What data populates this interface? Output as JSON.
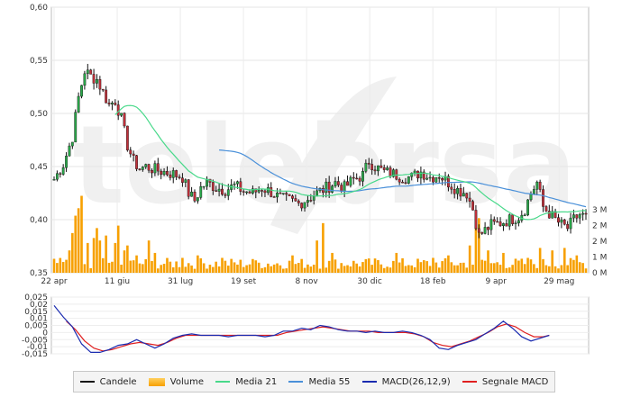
{
  "chart_data": [
    {
      "type": "candlestick",
      "title": "",
      "watermark": "telebrsa",
      "x_tick_labels": [
        "22 apr",
        "11 giu",
        "31 lug",
        "19 set",
        "8 nov",
        "30 dic",
        "18 feb",
        "9 apr",
        "29 mag"
      ],
      "y_tick_labels": [
        "0,35",
        "0,40",
        "0,45",
        "0,50",
        "0,55",
        "0,60"
      ],
      "ylim": [
        0.35,
        0.6
      ],
      "grid": true,
      "price_anchors": [
        [
          0,
          0.438
        ],
        [
          3,
          0.452
        ],
        [
          6,
          0.478
        ],
        [
          8,
          0.515
        ],
        [
          10,
          0.54
        ],
        [
          12,
          0.535
        ],
        [
          14,
          0.532
        ],
        [
          16,
          0.52
        ],
        [
          18,
          0.508
        ],
        [
          20,
          0.512
        ],
        [
          22,
          0.495
        ],
        [
          24,
          0.47
        ],
        [
          26,
          0.455
        ],
        [
          28,
          0.448
        ],
        [
          30,
          0.45
        ],
        [
          33,
          0.447
        ],
        [
          36,
          0.445
        ],
        [
          39,
          0.443
        ],
        [
          42,
          0.44
        ],
        [
          44,
          0.425
        ],
        [
          46,
          0.418
        ],
        [
          48,
          0.43
        ],
        [
          50,
          0.435
        ],
        [
          53,
          0.43
        ],
        [
          56,
          0.428
        ],
        [
          59,
          0.432
        ],
        [
          62,
          0.427
        ],
        [
          65,
          0.425
        ],
        [
          68,
          0.43
        ],
        [
          71,
          0.426
        ],
        [
          74,
          0.42
        ],
        [
          77,
          0.418
        ],
        [
          80,
          0.415
        ],
        [
          83,
          0.42
        ],
        [
          86,
          0.425
        ],
        [
          89,
          0.43
        ],
        [
          92,
          0.435
        ],
        [
          95,
          0.43
        ],
        [
          98,
          0.438
        ],
        [
          101,
          0.442
        ],
        [
          103,
          0.455
        ],
        [
          105,
          0.45
        ],
        [
          108,
          0.445
        ],
        [
          111,
          0.443
        ],
        [
          114,
          0.44
        ],
        [
          117,
          0.44
        ],
        [
          120,
          0.445
        ],
        [
          123,
          0.44
        ],
        [
          126,
          0.442
        ],
        [
          129,
          0.435
        ],
        [
          132,
          0.428
        ],
        [
          135,
          0.425
        ],
        [
          137,
          0.41
        ],
        [
          139,
          0.385
        ],
        [
          141,
          0.39
        ],
        [
          143,
          0.395
        ],
        [
          146,
          0.397
        ],
        [
          149,
          0.4
        ],
        [
          152,
          0.403
        ],
        [
          154,
          0.41
        ],
        [
          156,
          0.425
        ],
        [
          158,
          0.435
        ],
        [
          160,
          0.412
        ],
        [
          162,
          0.406
        ],
        [
          164,
          0.4
        ],
        [
          166,
          0.395
        ],
        [
          168,
          0.392
        ],
        [
          170,
          0.4
        ],
        [
          172,
          0.405
        ],
        [
          174,
          0.402
        ]
      ],
      "series": [
        {
          "name": "Candele",
          "color": "#111111"
        },
        {
          "name": "Volume",
          "color": "#f7a000"
        },
        {
          "name": "Media 21",
          "color": "#48d98a"
        },
        {
          "name": "Media 55",
          "color": "#4a90d9"
        }
      ],
      "volume_axis": {
        "tick_labels": [
          "0 M",
          "1 M",
          "2 M",
          "2 M",
          "3 M"
        ],
        "ylim_millions": [
          0,
          3.3
        ],
        "spikes": [
          [
            5,
            0.9
          ],
          [
            6,
            1.6
          ],
          [
            7,
            2.3
          ],
          [
            8,
            2.6
          ],
          [
            9,
            3.1
          ],
          [
            11,
            1.2
          ],
          [
            13,
            1.4
          ],
          [
            14,
            1.8
          ],
          [
            15,
            1.3
          ],
          [
            17,
            1.5
          ],
          [
            20,
            1.2
          ],
          [
            21,
            1.9
          ],
          [
            23,
            0.9
          ],
          [
            24,
            1.1
          ],
          [
            27,
            0.7
          ],
          [
            31,
            1.3
          ],
          [
            33,
            0.8
          ],
          [
            42,
            0.6
          ],
          [
            47,
            0.7
          ],
          [
            55,
            0.6
          ],
          [
            66,
            0.5
          ],
          [
            78,
            0.7
          ],
          [
            86,
            1.3
          ],
          [
            88,
            2.0
          ],
          [
            91,
            0.8
          ],
          [
            112,
            0.8
          ],
          [
            124,
            0.6
          ],
          [
            129,
            0.7
          ],
          [
            136,
            1.1
          ],
          [
            138,
            1.8
          ],
          [
            139,
            2.2
          ],
          [
            142,
            0.9
          ],
          [
            147,
            0.8
          ],
          [
            155,
            0.6
          ],
          [
            159,
            1.0
          ],
          [
            163,
            0.9
          ],
          [
            167,
            1.0
          ],
          [
            171,
            0.7
          ]
        ]
      }
    },
    {
      "type": "line",
      "title": "",
      "y_tick_labels": [
        "-0,015",
        "-0,01",
        "-0,005",
        "0",
        "0,005",
        "0,01",
        "0,015",
        "0,02",
        "0,025"
      ],
      "ylim": [
        -0.015,
        0.025
      ],
      "grid": true,
      "series": [
        {
          "name": "MACD(26,12,9)",
          "color": "#1a2bb0",
          "anchors": [
            [
              0,
              0.019
            ],
            [
              3,
              0.011
            ],
            [
              6,
              0.004
            ],
            [
              9,
              -0.008
            ],
            [
              12,
              -0.014
            ],
            [
              15,
              -0.014
            ],
            [
              18,
              -0.012
            ],
            [
              21,
              -0.009
            ],
            [
              24,
              -0.008
            ],
            [
              27,
              -0.005
            ],
            [
              30,
              -0.008
            ],
            [
              33,
              -0.011
            ],
            [
              36,
              -0.008
            ],
            [
              39,
              -0.004
            ],
            [
              42,
              -0.002
            ],
            [
              45,
              -0.001
            ],
            [
              48,
              -0.002
            ],
            [
              51,
              -0.002
            ],
            [
              54,
              -0.002
            ],
            [
              57,
              -0.003
            ],
            [
              60,
              -0.002
            ],
            [
              63,
              -0.002
            ],
            [
              66,
              -0.002
            ],
            [
              69,
              -0.003
            ],
            [
              72,
              -0.002
            ],
            [
              75,
              0.001
            ],
            [
              78,
              0.001
            ],
            [
              81,
              0.003
            ],
            [
              84,
              0.002
            ],
            [
              87,
              0.005
            ],
            [
              90,
              0.004
            ],
            [
              93,
              0.002
            ],
            [
              96,
              0.001
            ],
            [
              99,
              0.001
            ],
            [
              102,
              0.0
            ],
            [
              105,
              0.001
            ],
            [
              108,
              0.0
            ],
            [
              111,
              0.0
            ],
            [
              114,
              0.001
            ],
            [
              117,
              0.0
            ],
            [
              120,
              -0.002
            ],
            [
              123,
              -0.005
            ],
            [
              126,
              -0.011
            ],
            [
              129,
              -0.012
            ],
            [
              132,
              -0.009
            ],
            [
              135,
              -0.007
            ],
            [
              138,
              -0.005
            ],
            [
              141,
              -0.001
            ],
            [
              144,
              0.003
            ],
            [
              147,
              0.008
            ],
            [
              150,
              0.003
            ],
            [
              153,
              -0.003
            ],
            [
              156,
              -0.006
            ],
            [
              159,
              -0.004
            ],
            [
              162,
              -0.002
            ]
          ]
        },
        {
          "name": "Segnale MACD",
          "color": "#e02020",
          "anchors": [
            [
              4,
              0.008
            ],
            [
              7,
              0.002
            ],
            [
              10,
              -0.006
            ],
            [
              13,
              -0.011
            ],
            [
              16,
              -0.013
            ],
            [
              19,
              -0.012
            ],
            [
              22,
              -0.01
            ],
            [
              25,
              -0.008
            ],
            [
              28,
              -0.007
            ],
            [
              31,
              -0.008
            ],
            [
              34,
              -0.009
            ],
            [
              37,
              -0.007
            ],
            [
              40,
              -0.004
            ],
            [
              43,
              -0.002
            ],
            [
              46,
              -0.002
            ],
            [
              49,
              -0.002
            ],
            [
              52,
              -0.002
            ],
            [
              55,
              -0.002
            ],
            [
              58,
              -0.002
            ],
            [
              61,
              -0.002
            ],
            [
              64,
              -0.002
            ],
            [
              67,
              -0.002
            ],
            [
              70,
              -0.002
            ],
            [
              73,
              -0.002
            ],
            [
              76,
              0.0
            ],
            [
              79,
              0.001
            ],
            [
              82,
              0.002
            ],
            [
              85,
              0.003
            ],
            [
              88,
              0.004
            ],
            [
              91,
              0.003
            ],
            [
              94,
              0.002
            ],
            [
              97,
              0.001
            ],
            [
              100,
              0.001
            ],
            [
              103,
              0.001
            ],
            [
              106,
              0.0
            ],
            [
              109,
              0.0
            ],
            [
              112,
              0.0
            ],
            [
              115,
              0.0
            ],
            [
              118,
              -0.001
            ],
            [
              121,
              -0.003
            ],
            [
              124,
              -0.007
            ],
            [
              127,
              -0.009
            ],
            [
              130,
              -0.01
            ],
            [
              133,
              -0.008
            ],
            [
              136,
              -0.006
            ],
            [
              139,
              -0.003
            ],
            [
              142,
              0.0
            ],
            [
              145,
              0.004
            ],
            [
              148,
              0.006
            ],
            [
              151,
              0.004
            ],
            [
              154,
              0.0
            ],
            [
              157,
              -0.003
            ],
            [
              160,
              -0.003
            ],
            [
              162,
              -0.002
            ]
          ]
        }
      ]
    }
  ],
  "legend": [
    {
      "label": "Candele",
      "color": "#111111",
      "kind": "line"
    },
    {
      "label": "Volume",
      "color": "#f7a000",
      "kind": "block"
    },
    {
      "label": "Media 21",
      "color": "#48d98a",
      "kind": "line"
    },
    {
      "label": "Media 55",
      "color": "#4a90d9",
      "kind": "line"
    },
    {
      "label": "MACD(26,12,9)",
      "color": "#1a2bb0",
      "kind": "line"
    },
    {
      "label": "Segnale MACD",
      "color": "#e02020",
      "kind": "line"
    }
  ]
}
